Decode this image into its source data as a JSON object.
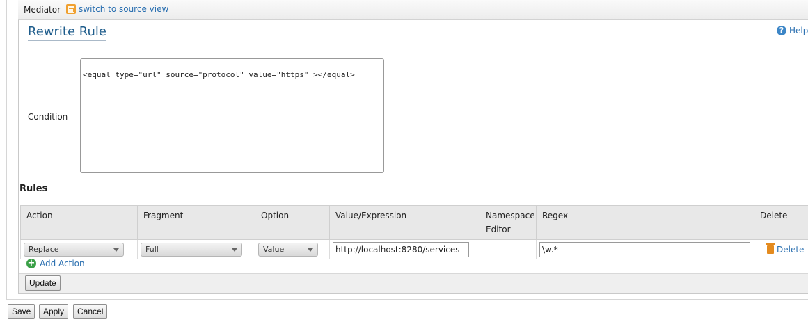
{
  "header": {
    "mediator_label": "Mediator",
    "switch_link": "switch to source view"
  },
  "section": {
    "title": "Rewrite Rule",
    "help": "Help"
  },
  "condition": {
    "label": "Condition",
    "value": "<equal type=\"url\" source=\"protocol\" value=\"https\" ></equal>"
  },
  "rules": {
    "label": "Rules",
    "columns": [
      "Action",
      "Fragment",
      "Option",
      "Value/Expression",
      "Namespace Editor",
      "Regex",
      "Delete"
    ],
    "rows": [
      {
        "action": "Replace",
        "fragment": "Full",
        "option": "Value",
        "value_expression": "http://localhost:8280/services",
        "namespace_editor": "",
        "regex": "\\w.*",
        "delete": "Delete"
      }
    ],
    "add_action": "Add Action",
    "update": "Update"
  },
  "footer": {
    "save": "Save",
    "apply": "Apply",
    "cancel": "Cancel"
  }
}
